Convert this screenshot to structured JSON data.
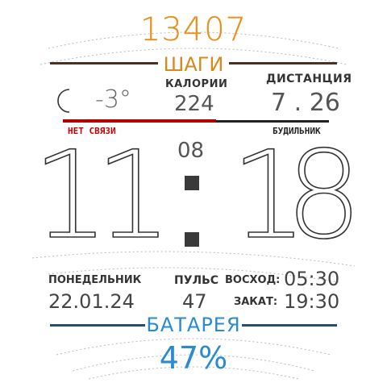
{
  "steps": {
    "value": "13407",
    "label": "ШАГИ"
  },
  "weather": {
    "icon": "moon-icon",
    "temperature": "-3°"
  },
  "calories": {
    "label": "КАЛОРИИ",
    "value": "224"
  },
  "distance": {
    "label": "ДИСТАНЦИЯ",
    "value": "7 . 26"
  },
  "status": {
    "no_connection": "НЕТ СВЯЗИ",
    "alarm": "БУДИЛЬНИК"
  },
  "time": {
    "hour1": "1",
    "hour2": "1",
    "min1": "1",
    "min2": "8",
    "seconds": "08"
  },
  "date": {
    "weekday": "ПОНЕДЕЛЬНИК",
    "date": "22.01.24"
  },
  "pulse": {
    "label": "ПУЛЬС",
    "value": "47"
  },
  "sun": {
    "sunrise_label": "ВОСХОД:",
    "sunrise": "05:30",
    "sunset_label": "ЗАКАТ:",
    "sunset": "19:30"
  },
  "battery": {
    "label": "БАТАРЕЯ",
    "value": "47%"
  },
  "colors": {
    "steps": "#e8901e",
    "battery": "#2a8bd0",
    "alert": "#c40000",
    "divider": "#4a3222"
  }
}
